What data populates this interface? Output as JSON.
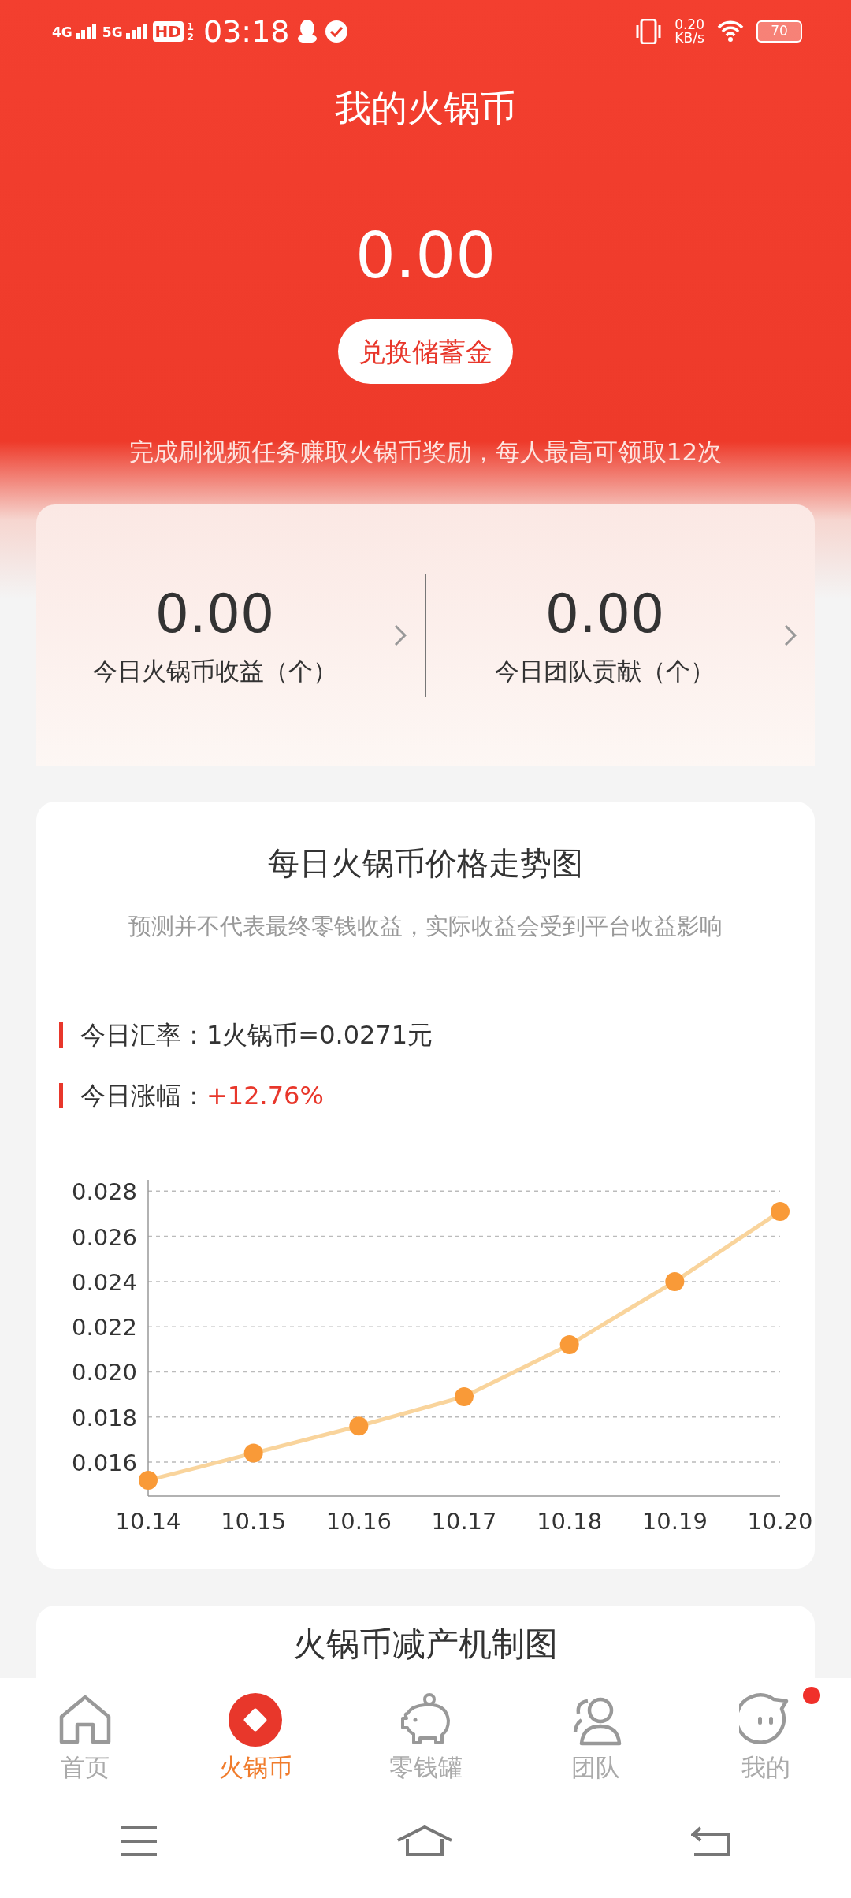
{
  "status_bar": {
    "network_1": "4G",
    "network_2": "5G",
    "hd": "HD",
    "hd_sim_1": "1",
    "hd_sim_2": "2",
    "time": "03:18",
    "speed": "0.20",
    "speed_unit": "KB/s",
    "battery": "70"
  },
  "title": "我的火锅币",
  "balance": "0.00",
  "exchange_button": "兑换储蓄金",
  "notice": "完成刷视频任务赚取火锅币奖励，每人最高可领取12次",
  "stats": [
    {
      "value": "0.00",
      "label": "今日火锅币收益（个）"
    },
    {
      "value": "0.00",
      "label": "今日团队贡献（个）"
    }
  ],
  "price_card": {
    "title": "每日火锅币价格走势图",
    "subtitle": "预测并不代表最终零钱收益，实际收益会受到平台收益影响",
    "facts": [
      {
        "label": "今日汇率：",
        "value": "1火锅币=0.0271元",
        "emphasis": false
      },
      {
        "label": "今日涨幅：",
        "value": "+12.76%",
        "emphasis": true
      }
    ],
    "chart_data": {
      "type": "line",
      "categories": [
        "10.14",
        "10.15",
        "10.16",
        "10.17",
        "10.18",
        "10.19",
        "10.20"
      ],
      "series": [
        {
          "color": "#f9d49c",
          "marker": true,
          "values": [
            0.0152,
            0.0164,
            0.0176,
            0.0189,
            0.0212,
            0.024,
            0.0271
          ]
        }
      ],
      "ylim": [
        0.0145,
        0.0285
      ],
      "grid": true,
      "yticks": [
        {
          "value": 0.016,
          "label": "0.016"
        },
        {
          "value": 0.018,
          "label": "0.018"
        },
        {
          "value": 0.02,
          "label": "0.020"
        },
        {
          "value": 0.022,
          "label": "0.022"
        },
        {
          "value": 0.024,
          "label": "0.024"
        },
        {
          "value": 0.026,
          "label": "0.026"
        },
        {
          "value": 0.028,
          "label": "0.028"
        }
      ]
    }
  },
  "next_card": {
    "title": "火锅币减产机制图"
  },
  "tabs": [
    {
      "kind": "home",
      "label": "首页",
      "selected": false,
      "dot": false
    },
    {
      "kind": "coin",
      "label": "火锅币",
      "selected": true,
      "dot": false
    },
    {
      "kind": "piggy",
      "label": "零钱罐",
      "selected": false,
      "dot": false
    },
    {
      "kind": "team",
      "label": "团队",
      "selected": false,
      "dot": false
    },
    {
      "kind": "me",
      "label": "我的",
      "selected": false,
      "dot": true
    }
  ]
}
